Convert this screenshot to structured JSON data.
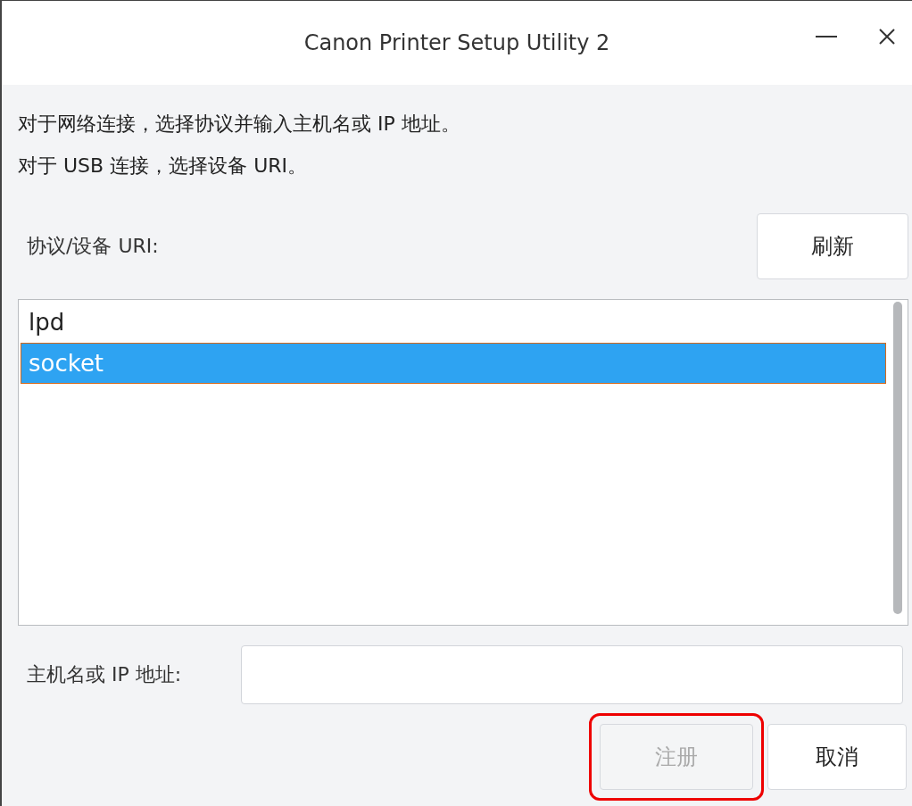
{
  "window": {
    "title": "Canon Printer Setup Utility 2"
  },
  "instructions": [
    "对于网络连接，选择协议并输入主机名或 IP 地址。",
    "对于 USB 连接，选择设备 URI。"
  ],
  "protocol_label": "协议/设备 URI:",
  "refresh_button": {
    "label": "刷新",
    "disabled": false
  },
  "protocols": [
    {
      "label": "lpd",
      "selected": false
    },
    {
      "label": "socket",
      "selected": true
    }
  ],
  "host": {
    "label": "主机名或 IP 地址:"
  },
  "buttons": [
    {
      "label": "注册",
      "disabled": true,
      "highlighted": true
    },
    {
      "label": "取消",
      "disabled": false,
      "highlighted": false
    }
  ]
}
